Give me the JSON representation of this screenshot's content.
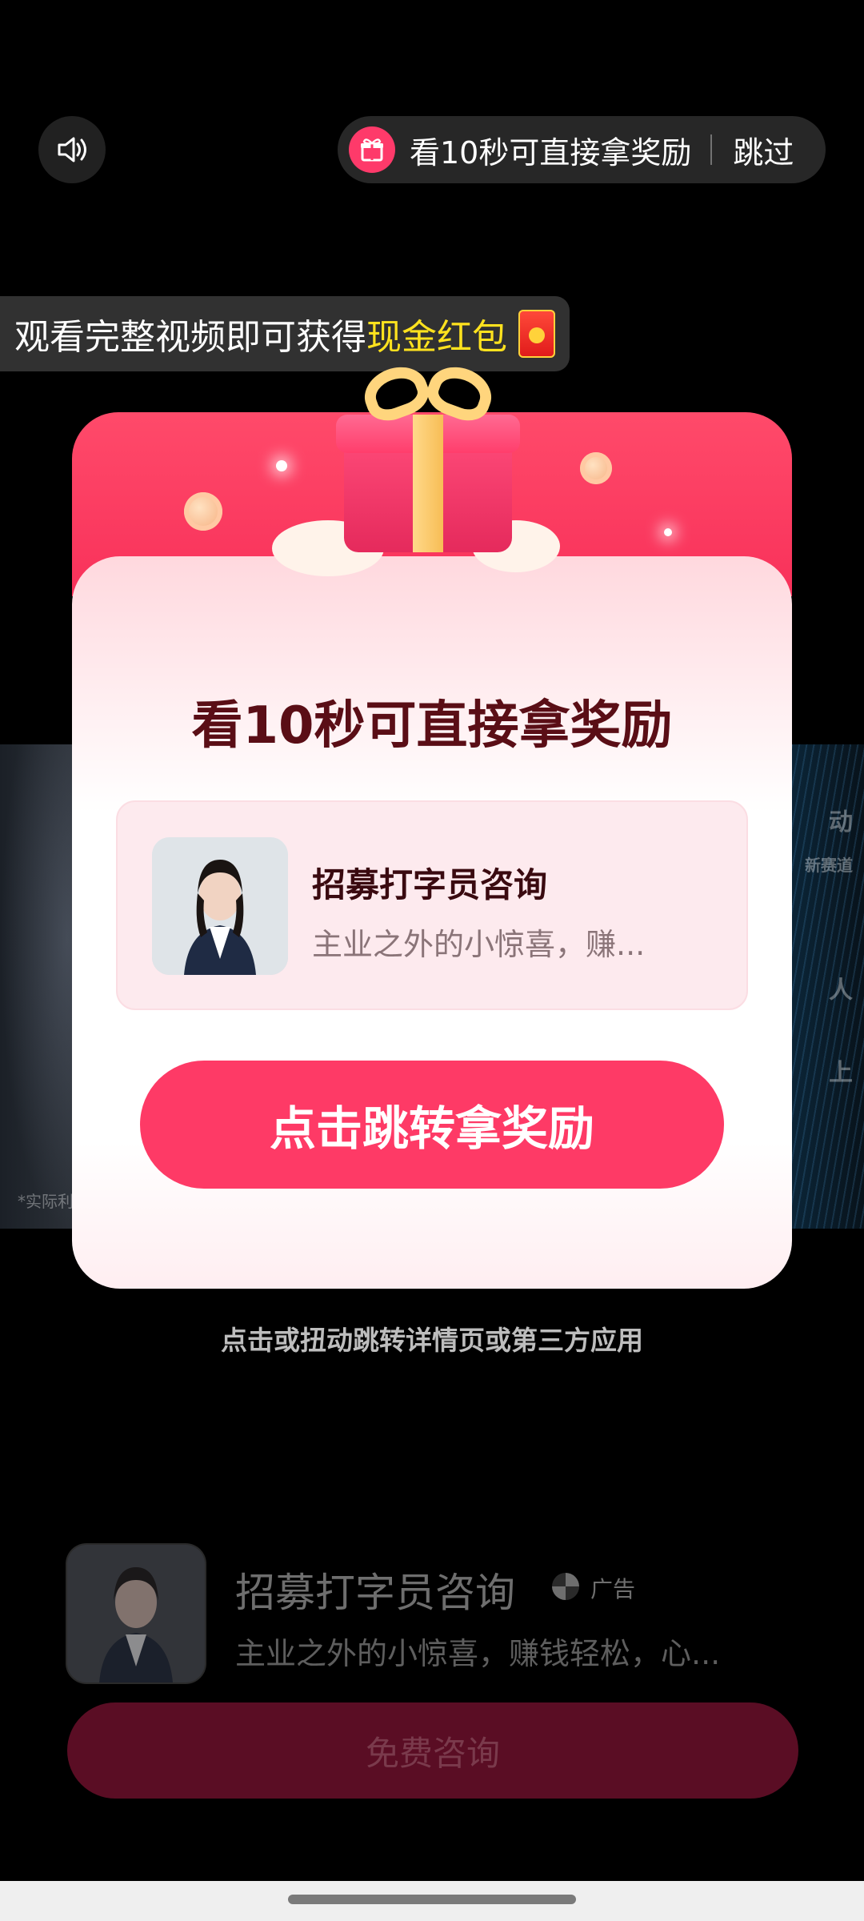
{
  "top_bar": {
    "sound_icon": "speaker-icon",
    "reward_text": "看10秒可直接拿奖励",
    "skip_label": "跳过",
    "gift_icon": "gift-icon"
  },
  "banner": {
    "text_prefix": "观看完整视频即可获得",
    "text_highlight": "现金红包",
    "icon": "red-envelope-icon"
  },
  "background_video": {
    "footnote": "*实际利",
    "right_texts": [
      "动",
      "新赛道",
      "人",
      "上"
    ]
  },
  "modal": {
    "title": "看10秒可直接拿奖励",
    "ad_title": "招募打字员咨询",
    "ad_desc": "主业之外的小惊喜，赚...",
    "cta_label": "点击跳转拿奖励"
  },
  "hint": "点击或扭动跳转详情页或第三方应用",
  "bottom_ad": {
    "title": "招募打字员咨询",
    "tag": "广告",
    "desc": "主业之外的小惊喜，赚钱轻松，心...",
    "button_label": "免费咨询"
  },
  "colors": {
    "accent": "#fe3a66",
    "title_dark": "#5a0e16",
    "banner_highlight": "#ffe21e"
  }
}
